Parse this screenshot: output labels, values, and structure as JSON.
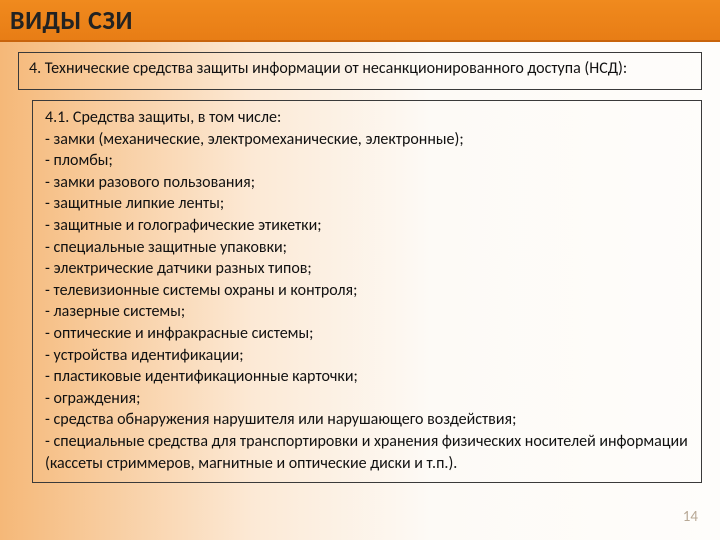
{
  "title": "ВИДЫ СЗИ",
  "intro": "4. Технические средства защиты информации от несанкционированного доступа (НСД):",
  "list": {
    "heading": "4.1. Средства защиты, в том числе:",
    "items": [
      "- замки (механические, электромеханические, электронные);",
      "- пломбы;",
      "- замки разового пользования;",
      "- защитные липкие ленты;",
      "- защитные и голографические этикетки;",
      "- специальные защитные упаковки;",
      "- электрические датчики разных типов;",
      "- телевизионные системы охраны и контроля;",
      "- лазерные системы;",
      "- оптические и инфракрасные системы;",
      "- устройства идентификации;",
      "- пластиковые идентификационные карточки;",
      "- ограждения;",
      "- средства обнаружения нарушителя или нарушающего воздействия;",
      "- специальные средства для транспортировки и хранения физических носителей информации (кассеты стриммеров, магнитные и оптические диски и т.п.)."
    ]
  },
  "page_number": "14"
}
